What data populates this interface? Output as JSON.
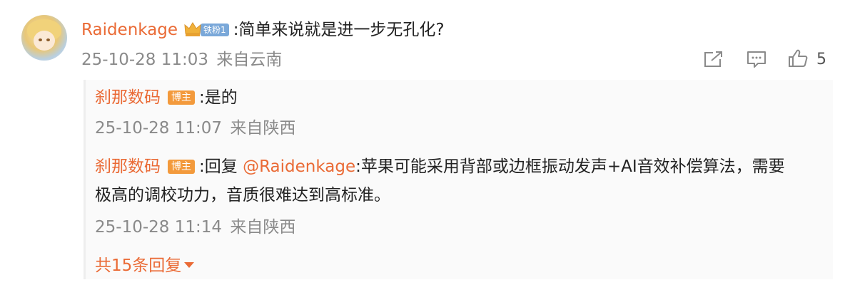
{
  "comment": {
    "author": "Raidenkage",
    "fan_badge": "铁粉1",
    "text": ":简单来说就是进一步无孔化?",
    "time": "25-10-28 11:03",
    "location": "来自云南",
    "likes": "5"
  },
  "replies": [
    {
      "author": "刹那数码",
      "badge": "博主",
      "text": ":是的",
      "time": "25-10-28 11:07",
      "location": "来自陕西"
    },
    {
      "author": "刹那数码",
      "badge": "博主",
      "prefix": ":回复 ",
      "mention": "@Raidenkage",
      "text_line1": ":苹果可能采用背部或边框振动发声+AI音效补偿算法，需要",
      "text_line2": "极高的调校功力，音质很难达到高标准。",
      "time": "25-10-28 11:14",
      "location": "来自陕西"
    }
  ],
  "more_replies": "共15条回复",
  "icons": [
    "share-icon",
    "comment-icon",
    "like-icon",
    "crown-icon",
    "caret-down-icon"
  ],
  "colors": {
    "name": "#ea6a35",
    "meta": "#8a8a8a",
    "host_badge": "#f39a3c",
    "fan_badge": "#7aa8d9"
  }
}
